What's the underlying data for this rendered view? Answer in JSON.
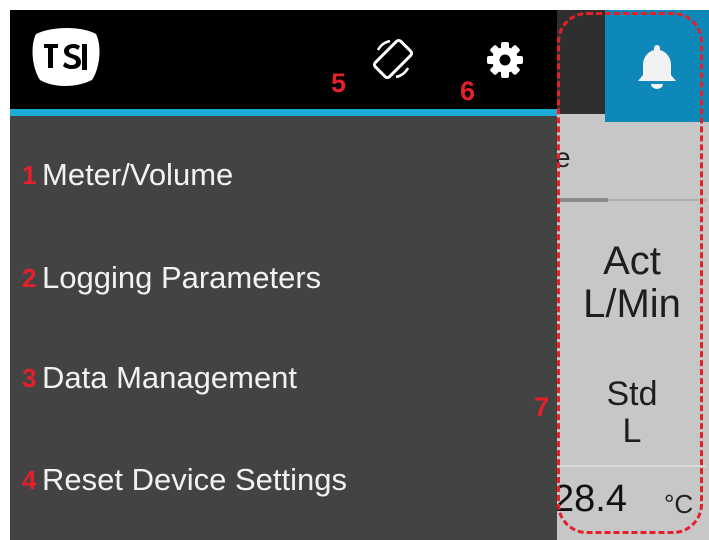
{
  "header": {
    "logo_text": "TSI",
    "rotate_icon": "screen-rotation-icon",
    "settings_icon": "gear-icon"
  },
  "menu": {
    "items": [
      {
        "number": "1",
        "label": "Meter/Volume"
      },
      {
        "number": "2",
        "label": "Logging Parameters"
      },
      {
        "number": "3",
        "label": "Data Management"
      },
      {
        "number": "4",
        "label": "Reset Device Settings"
      }
    ]
  },
  "callouts": {
    "rotate": "5",
    "settings": "6",
    "background_area": "7"
  },
  "background_app": {
    "alert_icon": "bell-icon",
    "tab_fragment": "e",
    "act_label_line1": "Act",
    "act_label_line2": "L/Min",
    "std_label_line1": "Std",
    "std_label_line2": "L",
    "reading": "28.4",
    "reading_unit": "°C"
  },
  "colors": {
    "header_background": "#000000",
    "accent_bar": "#1dacd8",
    "drawer_background": "#434343",
    "menu_text": "#f2f2f2",
    "callout_red": "#e4202a",
    "alert_blue": "#0e88b8",
    "app_background": "#c7c7c7"
  }
}
